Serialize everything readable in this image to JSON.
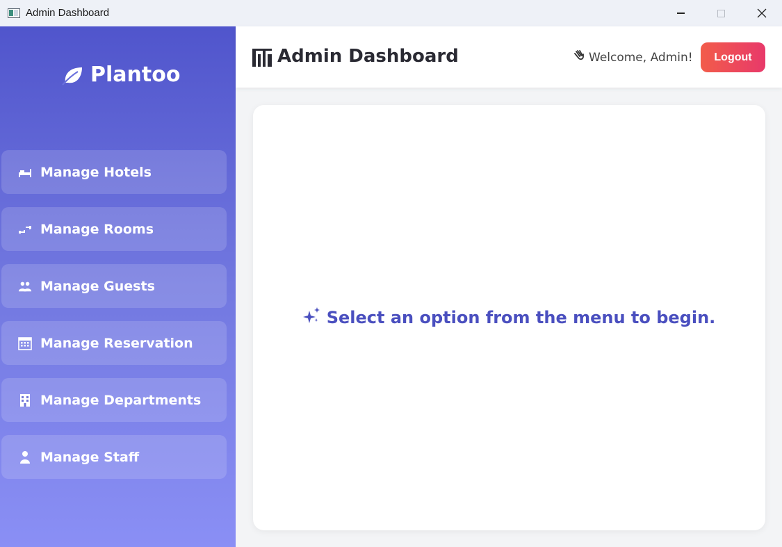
{
  "window": {
    "title": "Admin Dashboard",
    "icon": "app-window-icon"
  },
  "sidebar": {
    "brand": "Plantoo",
    "brand_icon": "leaf-icon",
    "items": [
      {
        "label": "Manage Hotels",
        "icon": "bed-icon"
      },
      {
        "label": "Manage Rooms",
        "icon": "key-icon"
      },
      {
        "label": "Manage Guests",
        "icon": "people-icon"
      },
      {
        "label": "Manage Reservation",
        "icon": "calendar-icon"
      },
      {
        "label": "Manage Departments",
        "icon": "building-icon"
      },
      {
        "label": "Manage Staff",
        "icon": "person-icon"
      }
    ]
  },
  "header": {
    "title": "Admin Dashboard",
    "icon": "bar-chart-icon",
    "welcome": "Welcome, Admin!",
    "welcome_icon": "waving-hand-icon",
    "logout_label": "Logout"
  },
  "main": {
    "prompt": "Select an option from the menu to begin.",
    "prompt_icon": "sparkles-icon"
  },
  "colors": {
    "sidebar_top": "#5055cc",
    "sidebar_bottom": "#8a8ff5",
    "accent_text": "#4a4fbf",
    "logout_start": "#f25c4a",
    "logout_end": "#e8396a"
  }
}
